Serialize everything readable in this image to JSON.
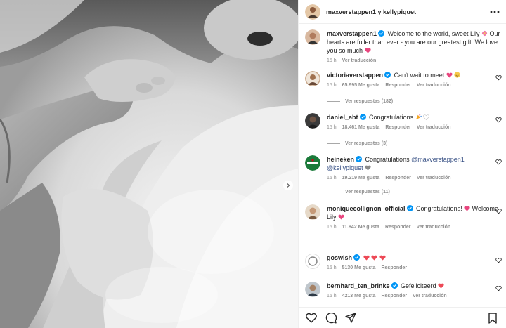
{
  "header": {
    "users": "maxverstappen1 y kellypiquet",
    "icons": [
      "avatar",
      "more-icon"
    ]
  },
  "caption": {
    "user": "maxverstappen1",
    "text": "Welcome to the world, sweet Lily",
    "text2": "Our hearts are fuller than ever - you are our greatest gift. We love you so much",
    "time": "15 h",
    "translate": "Ver traducción"
  },
  "comments": [
    {
      "user": "victoriaverstappen",
      "text": "Can't wait to meet",
      "time": "15 h",
      "likes": "65.995 Me gusta",
      "reply": "Responder",
      "translate": "Ver traducción",
      "replies": "Ver respuestas (182)"
    },
    {
      "user": "daniel_abt",
      "text": "Congratulations",
      "time": "15 h",
      "likes": "18.461 Me gusta",
      "reply": "Responder",
      "translate": "Ver traducción",
      "replies": "Ver respuestas (3)"
    },
    {
      "user": "heineken",
      "text": "Congratulations",
      "mention1": "@maxverstappen1",
      "mention2": "@kellypiquet",
      "time": "15 h",
      "likes": "19.219 Me gusta",
      "reply": "Responder",
      "translate": "Ver traducción",
      "replies": "Ver respuestas (11)"
    },
    {
      "user": "moniquecollignon_official",
      "text": "Congratulations!",
      "text2": "Welcome Lily",
      "time": "15 h",
      "likes": "11.842 Me gusta",
      "reply": "Responder",
      "translate": "Ver traducción"
    },
    {
      "user": "goswish",
      "text": "",
      "time": "15 h",
      "likes": "5130 Me gusta",
      "reply": "Responder"
    },
    {
      "user": "bernhard_ten_brinke",
      "text": "Gefeliciteerd",
      "time": "15 h",
      "likes": "4213 Me gusta",
      "reply": "Responder",
      "translate": "Ver traducción"
    }
  ],
  "colors": {
    "verified": "#0095f6",
    "emoji_heart": "#e8457e",
    "mention": "#385185",
    "meta": "#8e8e8e",
    "heineken": "#1b7a3a"
  },
  "action_icons": [
    "heart-icon",
    "comment-icon",
    "share-icon",
    "bookmark-icon"
  ]
}
